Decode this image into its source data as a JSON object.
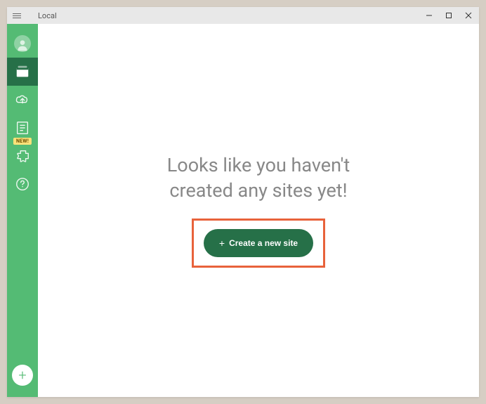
{
  "titlebar": {
    "title": "Local"
  },
  "sidebar": {
    "new_badge": "NEW!"
  },
  "main": {
    "heading_line1": "Looks like you haven't",
    "heading_line2": "created any sites yet!",
    "create_button_label": "Create a new site"
  }
}
